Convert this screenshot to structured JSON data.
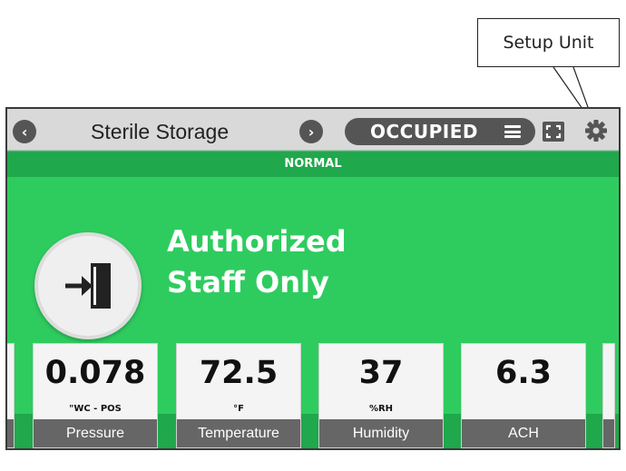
{
  "callout": {
    "text": "Setup Unit"
  },
  "header": {
    "room_name": "Sterile Storage",
    "mode": "OCCUPIED",
    "prev_icon": "chevron-left-icon",
    "next_icon": "chevron-right-icon",
    "menu_icon": "menu-icon",
    "fullscreen_icon": "fullscreen-icon",
    "setup_icon": "gear-icon"
  },
  "status": {
    "text": "NORMAL",
    "color": "#1fa84c"
  },
  "message": {
    "icon": "door-entry-icon",
    "line1": "Authorized",
    "line2": "Staff Only"
  },
  "tiles": [
    {
      "value": "0.078",
      "unit": "\"WC - POS",
      "label": "Pressure"
    },
    {
      "value": "72.5",
      "unit": "°F",
      "label": "Temperature"
    },
    {
      "value": "37",
      "unit": "%RH",
      "label": "Humidity"
    },
    {
      "value": "6.3",
      "unit": "",
      "label": "ACH"
    }
  ],
  "colors": {
    "panel": "#2ecc5f",
    "strip": "#1fa84c",
    "bar": "#d9d9d9",
    "pill": "#555555"
  }
}
